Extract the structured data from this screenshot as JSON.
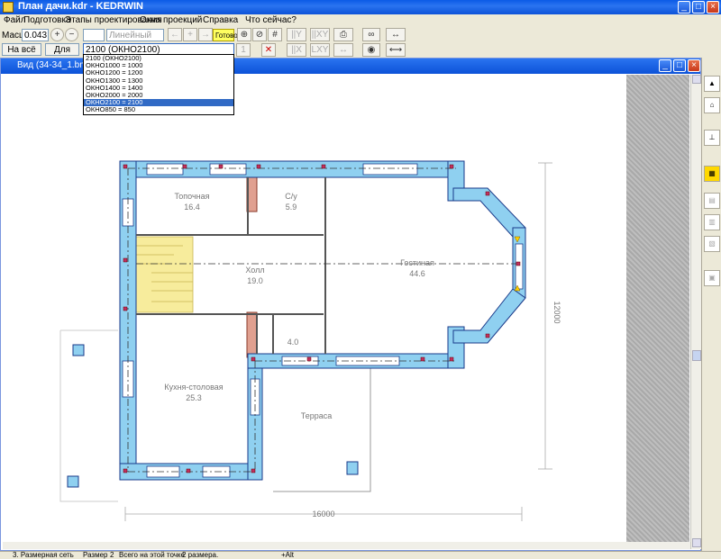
{
  "window": {
    "title": "План дачи.kdr - KEDRWIN",
    "min": "_",
    "max": "□",
    "close": "×"
  },
  "menu": [
    "Файл",
    "Подготовка",
    "Этапы проектирования",
    "Окна проекций",
    "Справка",
    "Что сейчас?"
  ],
  "toolbar": {
    "scale_label": "Масшт",
    "scale_value": "0.043",
    "zoom_in": "+",
    "zoom_out": "−",
    "fit_all": "На всё окно",
    "for_all": "Для всех",
    "line_type": "Линейный",
    "gotovo": "Готово",
    "window_select": "2100 (ОКНО2100)"
  },
  "window_options": [
    "2100 (ОКНО2100)",
    "ОКНО1000 = 1000",
    "ОКНО1200 = 1200",
    "ОКНО1300 = 1300",
    "ОКНО1400 = 1400",
    "ОКНО2000 = 2000",
    "ОКНО2100 = 2100",
    "ОКНО850 = 850"
  ],
  "selected_option_index": 6,
  "child_window": {
    "title": "Вид (34-34_1.bmp)"
  },
  "plan": {
    "rooms": [
      {
        "name": "Топочная",
        "area": "16.4"
      },
      {
        "name": "С/у",
        "area": "5.9"
      },
      {
        "name": "Холл",
        "area": "19.0"
      },
      {
        "name": "Гостиная",
        "area": "44.6"
      },
      {
        "name": "",
        "area": "4.0"
      },
      {
        "name": "Кухня-столовая",
        "area": "25.3"
      },
      {
        "name": "Терраса",
        "area": ""
      }
    ],
    "dim_width": "16000",
    "dim_height": "12000"
  },
  "status": {
    "mode": "3. Размерная сеть",
    "size_label": "Размер",
    "size_value": "2",
    "total_text": "Всего на этой точке",
    "total_value": "2 размера.",
    "key": "+Alt"
  },
  "colors": {
    "wall_fill": "#8fd0f0",
    "wall_stroke": "#1a3a8a",
    "stairs": "#f7ec9c",
    "brick": "#e0a090",
    "selection": "#316ac5"
  }
}
